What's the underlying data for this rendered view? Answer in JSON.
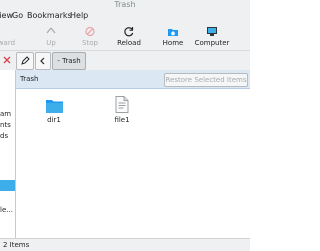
{
  "window": {
    "title": "Trash"
  },
  "menubar": {
    "items": [
      "View",
      "Go",
      "Bookmarks",
      "Help"
    ]
  },
  "toolbar": {
    "forward_label": "rward",
    "up_label": "Up",
    "stop_label": "Stop",
    "reload_label": "Reload",
    "home_label": "Home",
    "computer_label": "Computer"
  },
  "location": {
    "breadcrumb_label": "- Trash"
  },
  "sidebar": {
    "items": [
      "am",
      "nts",
      "ds",
      "le..."
    ]
  },
  "content": {
    "header_label": "Trash",
    "restore_button_label": "Restore Selected Items",
    "files": [
      {
        "name": "dir1",
        "icon": "folder-icon"
      },
      {
        "name": "file1",
        "icon": "text-file-icon"
      }
    ]
  },
  "statusbar": {
    "text": "2 Items"
  },
  "colors": {
    "accent": "#3daee9",
    "header_bg": "#dbe7f3",
    "chrome_bg": "#eff0f1",
    "close_red": "#da4453"
  }
}
